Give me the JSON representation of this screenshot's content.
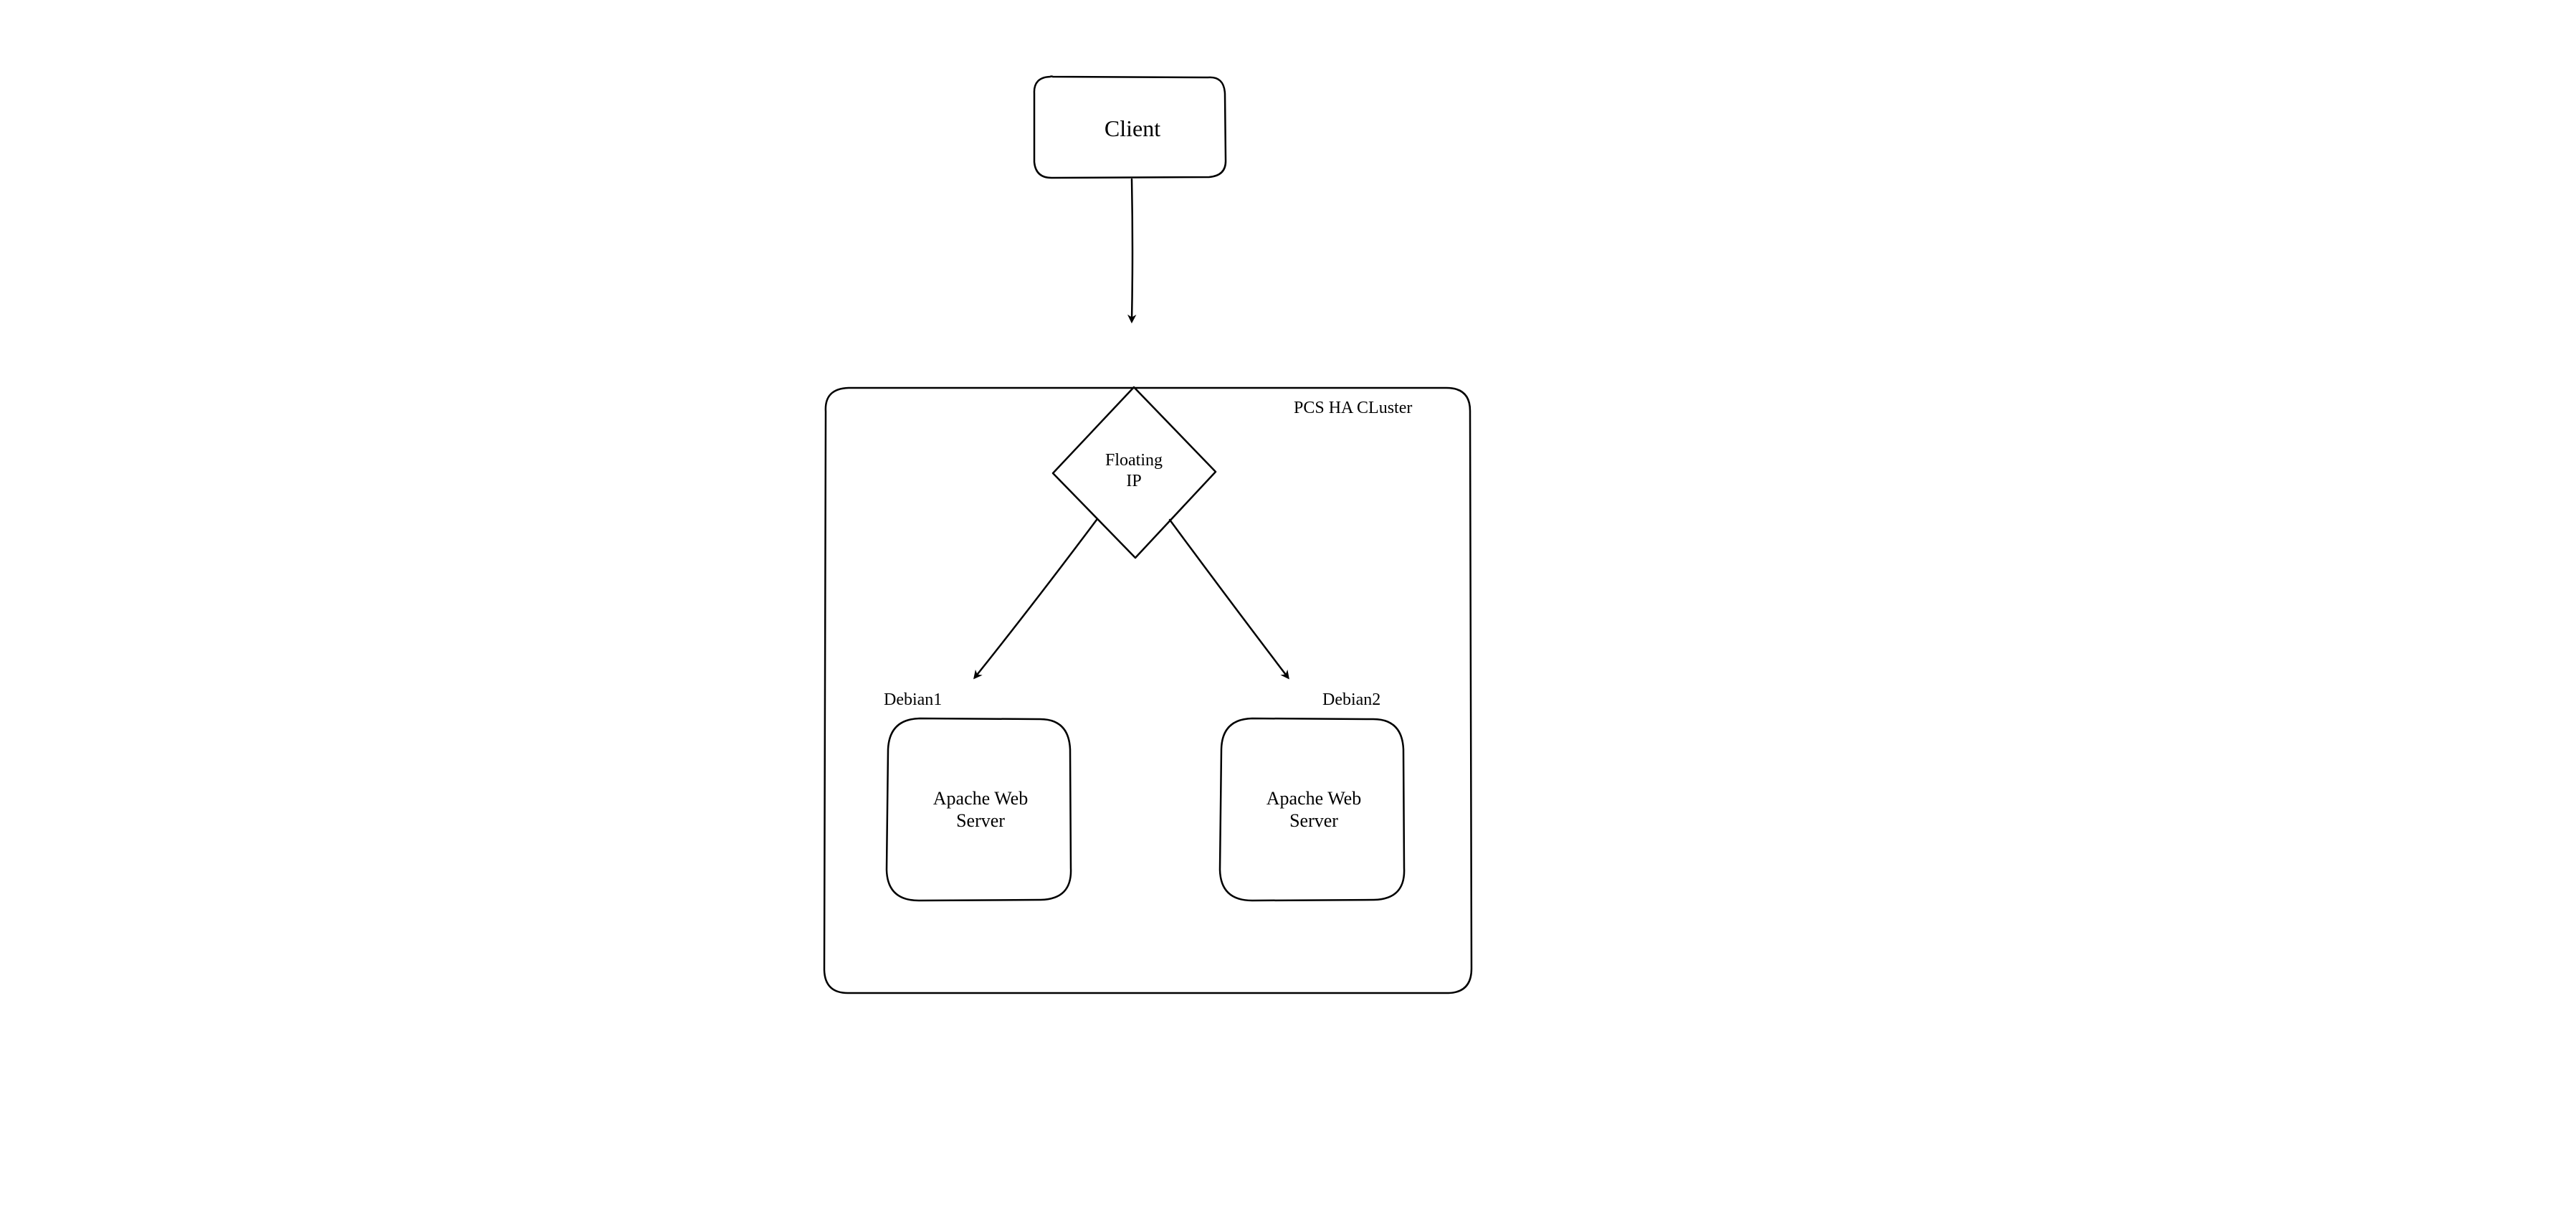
{
  "nodes": {
    "client": {
      "label": "Client",
      "fill": "#9FE29F"
    },
    "cluster": {
      "label": "PCS HA CLuster"
    },
    "floating_ip": {
      "label": "Floating\nIP",
      "fill": "#F5DCE0"
    },
    "debian1": {
      "label": "Debian1",
      "server_label": "Apache Web\nServer",
      "fill": "#A6CEE8"
    },
    "debian2": {
      "label": "Debian2",
      "server_label": "Apache Web\nServer",
      "fill": "#A6CEE8"
    }
  }
}
